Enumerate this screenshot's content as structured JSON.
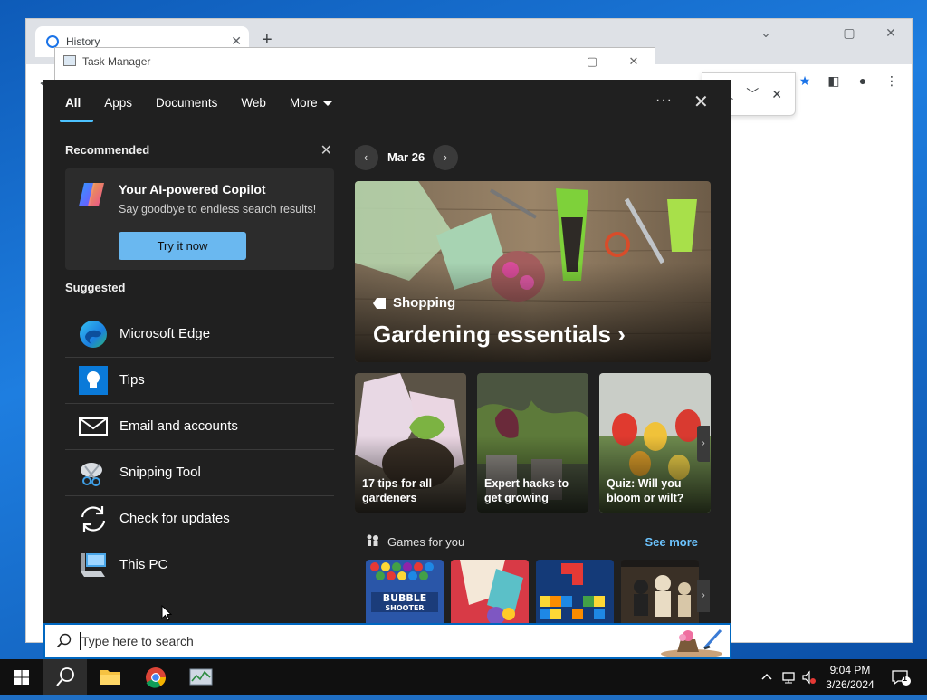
{
  "chrome": {
    "tab_title": "History",
    "tab_close": "✕",
    "new_tab": "+",
    "controls": [
      "⌄",
      "—",
      "▢",
      "✕"
    ],
    "toolbar_icons": [
      "key-icon",
      "zoom-icon",
      "share-icon",
      "star-icon",
      "sidepanel-icon",
      "profile-icon",
      "menu-icon"
    ],
    "find_controls": [
      "︿",
      "﹀",
      "✕"
    ]
  },
  "task_manager": {
    "title": "Task Manager",
    "controls": [
      "—",
      "▢",
      "✕"
    ]
  },
  "search_panel": {
    "tabs": [
      {
        "label": "All",
        "active": true
      },
      {
        "label": "Apps",
        "active": false
      },
      {
        "label": "Documents",
        "active": false
      },
      {
        "label": "Web",
        "active": false
      },
      {
        "label": "More",
        "active": false
      }
    ],
    "overflow": "···",
    "close": "✕",
    "recommended": {
      "heading": "Recommended",
      "card_title": "Your AI-powered Copilot",
      "card_subtitle": "Say goodbye to endless search results!",
      "button": "Try it now"
    },
    "suggested": {
      "heading": "Suggested",
      "items": [
        {
          "label": "Microsoft Edge",
          "icon": "edge-icon"
        },
        {
          "label": "Tips",
          "icon": "tips-icon"
        },
        {
          "label": "Email and accounts",
          "icon": "mail-icon"
        },
        {
          "label": "Snipping Tool",
          "icon": "snipping-tool-icon"
        },
        {
          "label": "Check for updates",
          "icon": "refresh-icon"
        },
        {
          "label": "This PC",
          "icon": "computer-icon"
        }
      ]
    },
    "highlights": {
      "date": "Mar 26",
      "hero_category": "Shopping",
      "hero_title": "Gardening essentials",
      "cards": [
        {
          "text": "17 tips for all gardeners"
        },
        {
          "text": "Expert hacks to get growing"
        },
        {
          "text": "Quiz: Will you bloom or wilt?"
        }
      ],
      "games_title": "Games for you",
      "see_more": "See more",
      "games": [
        "Bubble Shooter HD",
        "Paint game",
        "Block puzzle",
        "Chess"
      ]
    }
  },
  "search_box": {
    "placeholder": "Type here to search"
  },
  "taskbar": {
    "apps": [
      "start-icon",
      "search-icon",
      "file-explorer-icon",
      "chrome-icon",
      "task-manager-icon"
    ],
    "time": "9:04 PM",
    "date": "3/26/2024",
    "notification_count": "1",
    "colors": {
      "accent": "#0067c0",
      "panel_bg": "#202020",
      "link": "#6cc4ff"
    }
  }
}
